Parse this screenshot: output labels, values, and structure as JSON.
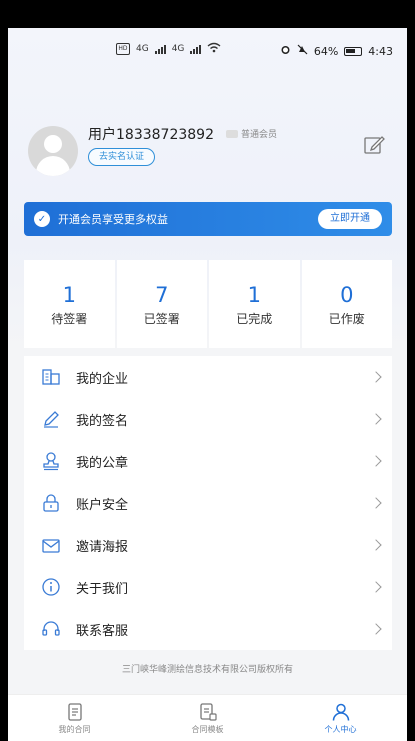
{
  "status_bar": {
    "sim_labels": [
      "HD",
      "HD"
    ],
    "network": [
      "4G",
      "4G"
    ],
    "battery": "64%",
    "time": "4:43"
  },
  "profile": {
    "username": "用户18338723892",
    "member_level": "普通会员",
    "verify_label": "去实名认证"
  },
  "vip_banner": {
    "text": "开通会员享受更多权益",
    "button": "立即开通"
  },
  "stats": [
    {
      "value": "1",
      "label": "待签署"
    },
    {
      "value": "7",
      "label": "已签署"
    },
    {
      "value": "1",
      "label": "已完成"
    },
    {
      "value": "0",
      "label": "已作废"
    }
  ],
  "menu": [
    {
      "label": "我的企业",
      "icon": "building-icon"
    },
    {
      "label": "我的签名",
      "icon": "pen-icon"
    },
    {
      "label": "我的公章",
      "icon": "stamp-icon"
    },
    {
      "label": "账户安全",
      "icon": "lock-icon"
    },
    {
      "label": "邀请海报",
      "icon": "envelope-icon"
    },
    {
      "label": "关于我们",
      "icon": "info-icon"
    },
    {
      "label": "联系客服",
      "icon": "headset-icon"
    }
  ],
  "copyright": "三门峡华峰测绘信息技术有限公司版权所有",
  "tabs": [
    {
      "label": "我的合同",
      "active": false
    },
    {
      "label": "合同模板",
      "active": false
    },
    {
      "label": "个人中心",
      "active": true
    }
  ],
  "colors": {
    "accent": "#1f6fd6",
    "background": "#f4f5f7"
  }
}
